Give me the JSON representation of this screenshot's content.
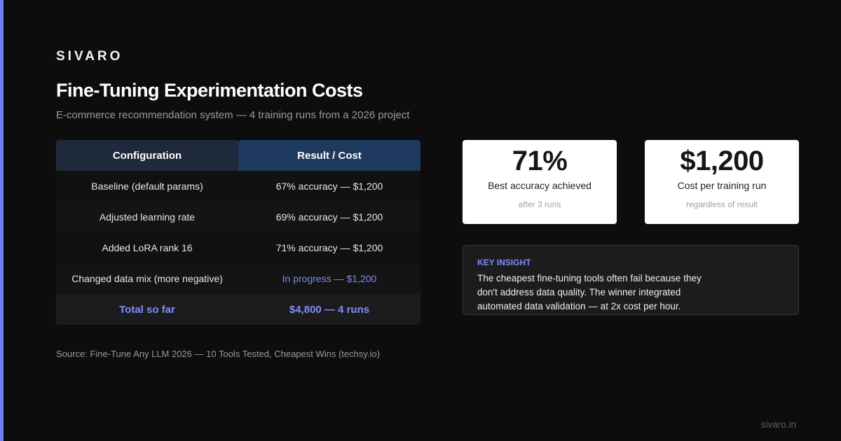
{
  "brand": {
    "name": "SIVARO",
    "accent_color": "#6f7ff0"
  },
  "header": {
    "title": "Fine-Tuning Experimentation Costs",
    "subtitle": "E-commerce recommendation system — 4 training runs from a 2026 project"
  },
  "table": {
    "columns": [
      "Configuration",
      "Result / Cost"
    ],
    "rows": [
      {
        "config": "Baseline (default params)",
        "result": "67% accuracy — $1,200"
      },
      {
        "config": "Adjusted learning rate",
        "result": "69% accuracy — $1,200"
      },
      {
        "config": "Added LoRA rank 16",
        "result": "71% accuracy — $1,200"
      },
      {
        "config": "Changed data mix (more negative)",
        "result": "In progress — $1,200"
      }
    ],
    "total": {
      "label": "Total so far",
      "value": "$4,800 — 4 runs"
    }
  },
  "stats": [
    {
      "value": "71%",
      "label": "Best accuracy achieved",
      "note": "after 3 runs"
    },
    {
      "value": "$1,200",
      "label": "Cost per training run",
      "note": "regardless of result"
    }
  ],
  "insight": {
    "label": "KEY INSIGHT",
    "text": "The cheapest fine-tuning tools often fail because they don't address data quality. The winner integrated automated data validation — at 2x cost per hour."
  },
  "source": "Source: Fine-Tune Any LLM 2026 — 10 Tools Tested, Cheapest Wins (techsy.io)",
  "footer": {
    "url": "sivaro.in"
  },
  "colors": {
    "background": "#0d0d0d",
    "highlight": "#818cf8",
    "header_left": "#1e293b",
    "header_right": "#1e3a5f"
  }
}
